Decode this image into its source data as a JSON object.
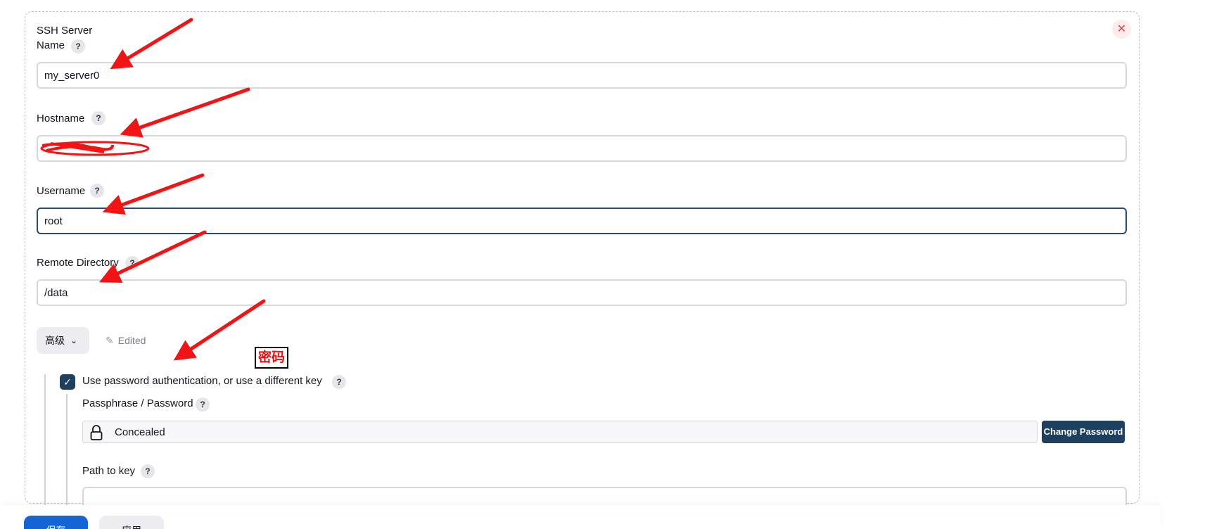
{
  "form": {
    "section_title": "SSH Server",
    "name": {
      "label": "Name",
      "value": "my_server0"
    },
    "hostname": {
      "label": "Hostname",
      "value": ""
    },
    "username": {
      "label": "Username",
      "value": "root"
    },
    "remote_directory": {
      "label": "Remote Directory",
      "value": "/data"
    },
    "help_glyph": "?"
  },
  "advanced": {
    "button_label": "高级",
    "edited_label": "Edited"
  },
  "annotation": {
    "tag_text": "密码"
  },
  "password_auth": {
    "checkbox_label": "Use password authentication, or use a different key",
    "checked": true,
    "passphrase_label": "Passphrase / Password",
    "password_value": "Concealed",
    "change_button": "Change Password",
    "path_to_key_label": "Path to key",
    "path_to_key_value": ""
  },
  "footer": {
    "save_label": "保存",
    "apply_label": "应用"
  },
  "icons": [
    "close-icon",
    "help-icon",
    "chevron-down-icon",
    "pencil-icon",
    "check-icon",
    "lock-icon"
  ],
  "colors": {
    "primary_blue": "#1364d4",
    "dark_navy": "#1e3f5e",
    "annotation_red": "#e01515"
  }
}
